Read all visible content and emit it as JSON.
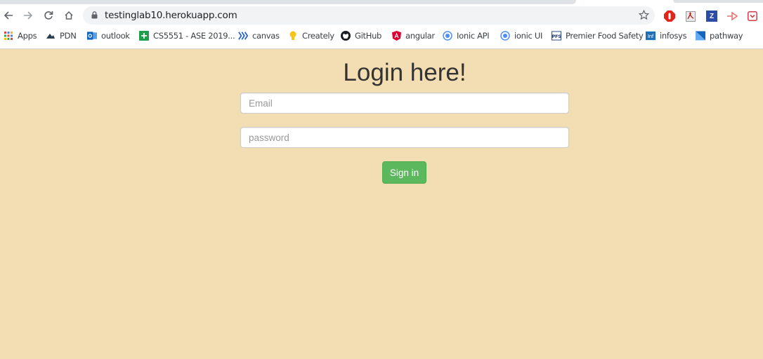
{
  "browser": {
    "url": "testinglab10.herokuapp.com",
    "bookmarks": [
      {
        "label": "Apps",
        "icon": "apps-grid-icon"
      },
      {
        "label": "PDN",
        "icon": "pdn-icon"
      },
      {
        "label": "outlook",
        "icon": "outlook-icon"
      },
      {
        "label": "CS5551 - ASE 2019...",
        "icon": "sheets-icon"
      },
      {
        "label": "canvas",
        "icon": "canvas-icon"
      },
      {
        "label": "Creately",
        "icon": "lightbulb-icon"
      },
      {
        "label": "GitHub",
        "icon": "github-icon"
      },
      {
        "label": "angular",
        "icon": "angular-icon"
      },
      {
        "label": "Ionic API",
        "icon": "ionic-icon"
      },
      {
        "label": "ionic UI",
        "icon": "ionic-icon"
      },
      {
        "label": "Premier Food Safety",
        "icon": "pfs-icon"
      },
      {
        "label": "infosys",
        "icon": "infosys-icon"
      },
      {
        "label": "pathway",
        "icon": "pathway-icon"
      }
    ],
    "extensions": [
      "adblock-icon",
      "pdf-icon",
      "z-icon",
      "arrow-ext-icon",
      "pocket-icon"
    ]
  },
  "page": {
    "title": "Login here!",
    "email_placeholder": "Email",
    "password_placeholder": "password",
    "signin_label": "Sign in",
    "background_color": "#f3deb4",
    "button_color": "#5cb85c"
  }
}
